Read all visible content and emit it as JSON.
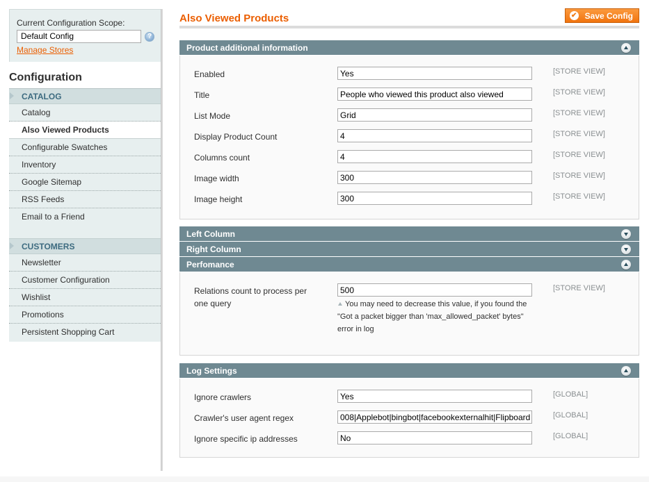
{
  "sidebar": {
    "scope_label": "Current Configuration Scope:",
    "scope_value": "Default Config",
    "help_icon": "question-circle-icon",
    "manage_stores": "Manage Stores",
    "config_title": "Configuration",
    "groups": [
      {
        "title": "CATALOG",
        "items": [
          {
            "label": "Catalog",
            "active": false
          },
          {
            "label": "Also Viewed Products",
            "active": true
          },
          {
            "label": "Configurable Swatches",
            "active": false
          },
          {
            "label": "Inventory",
            "active": false
          },
          {
            "label": "Google Sitemap",
            "active": false
          },
          {
            "label": "RSS Feeds",
            "active": false
          },
          {
            "label": "Email to a Friend",
            "active": false
          }
        ]
      },
      {
        "title": "CUSTOMERS",
        "items": [
          {
            "label": "Newsletter",
            "active": false
          },
          {
            "label": "Customer Configuration",
            "active": false
          },
          {
            "label": "Wishlist",
            "active": false
          },
          {
            "label": "Promotions",
            "active": false
          },
          {
            "label": "Persistent Shopping Cart",
            "active": false
          }
        ]
      }
    ]
  },
  "header": {
    "title": "Also Viewed Products",
    "save_label": "Save Config",
    "accent_color": "#eb5e00"
  },
  "sections": {
    "product_info": {
      "title": "Product additional information",
      "state": "expanded",
      "fields": [
        {
          "label": "Enabled",
          "value": "Yes",
          "scope": "[STORE VIEW]"
        },
        {
          "label": "Title",
          "value": "People who viewed this product also viewed",
          "scope": "[STORE VIEW]"
        },
        {
          "label": "List Mode",
          "value": "Grid",
          "scope": "[STORE VIEW]"
        },
        {
          "label": "Display Product Count",
          "value": "4",
          "scope": "[STORE VIEW]"
        },
        {
          "label": "Columns count",
          "value": "4",
          "scope": "[STORE VIEW]"
        },
        {
          "label": "Image width",
          "value": "300",
          "scope": "[STORE VIEW]"
        },
        {
          "label": "Image height",
          "value": "300",
          "scope": "[STORE VIEW]"
        }
      ]
    },
    "left_column": {
      "title": "Left Column",
      "state": "collapsed"
    },
    "right_column": {
      "title": "Right Column",
      "state": "collapsed"
    },
    "performance": {
      "title": "Perfomance",
      "state": "expanded",
      "field": {
        "label": "Relations count to process per one query",
        "value": "500",
        "scope": "[STORE VIEW]",
        "note": "You may need to decrease this value, if you found the \"Got a packet bigger than 'max_allowed_packet' bytes\" error in log"
      }
    },
    "log_settings": {
      "title": "Log Settings",
      "state": "expanded",
      "fields": [
        {
          "label": "Ignore crawlers",
          "value": "Yes",
          "scope": "[GLOBAL]"
        },
        {
          "label": "Crawler's user agent regex",
          "value": "008|Applebot|bingbot|facebookexternalhit|Flipboard",
          "scope": "[GLOBAL]"
        },
        {
          "label": "Ignore specific ip addresses",
          "value": "No",
          "scope": "[GLOBAL]"
        }
      ]
    }
  }
}
